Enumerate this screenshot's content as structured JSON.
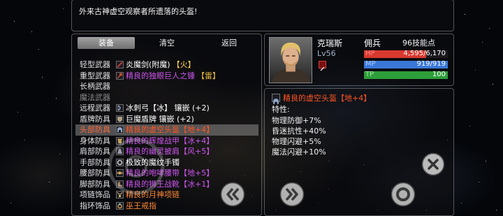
{
  "message": "外来古神虚空观察者所遗落的头盔!",
  "tabs": [
    {
      "label": "装备",
      "selected": true
    },
    {
      "label": "清空",
      "selected": false
    },
    {
      "label": "返回",
      "selected": false
    }
  ],
  "slots": [
    {
      "label": "轻型武器",
      "item": "炎魔剑(附魔)",
      "tag": "【火】",
      "item_color": "#ffffff",
      "tag_color": "#ffd24a",
      "icon": "sword-icon",
      "icon_color": "#e0443a"
    },
    {
      "label": "重型武器",
      "item": "精良的独眼巨人之锤",
      "tag": "【雷】",
      "item_color": "#cc55ee",
      "tag_color": "#f0c040",
      "icon": "hammer-icon",
      "icon_color": "#c0502a"
    },
    {
      "label": "长柄武器"
    },
    {
      "label": "魔法武器",
      "disabled": true
    },
    {
      "label": "远程武器",
      "item": "冰刺弓【冰】 镶嵌 (+2)",
      "item_color": "#ffffff",
      "icon": "bow-icon",
      "icon_color": "#9ab6d8"
    },
    {
      "label": "盾牌防具",
      "item": "巨魔盾牌 镶嵌 (+2)",
      "item_color": "#ffffff",
      "icon": "shield-icon",
      "icon_color": "#b0a080"
    },
    {
      "label": "头部防具",
      "item": "精良的虚空头盔【地+4】",
      "item_color": "#ff5522",
      "icon": "helmet-icon",
      "icon_color": "#8fa6c8",
      "selected": true
    },
    {
      "label": "身体防具",
      "item": "精良的辉煌战甲【冰+4】",
      "item_color": "#cc55ee",
      "icon": "armor-icon",
      "icon_color": "#c0a060"
    },
    {
      "label": "肩部防具",
      "item": "精良的幽灵披肩【风+5】",
      "item_color": "#cc55ee",
      "icon": "cloak-icon",
      "icon_color": "#9a9aaa"
    },
    {
      "label": "手部防具",
      "item": "极致的魔纹手镯",
      "item_color": "#ffffff",
      "icon": "bracer-icon",
      "icon_color": "#d0d0d0"
    },
    {
      "label": "腰部防具",
      "item": "精良的咆哮腰带【地+5】",
      "item_color": "#cc55ee",
      "icon": "belt-icon",
      "icon_color": "#a07850"
    },
    {
      "label": "脚部防具",
      "item": "精良的狮王战靴【冰+1】",
      "item_color": "#cc55ee",
      "icon": "boots-icon",
      "icon_color": "#9a7a5a"
    },
    {
      "label": "项链饰品",
      "item": "精良的月神项链",
      "item_color": "#ff8833",
      "icon": "necklace-icon",
      "icon_color": "#d8c070"
    },
    {
      "label": "指环饰品",
      "item": "巫王戒指",
      "item_color": "#ff8833",
      "icon": "ring-icon",
      "icon_color": "#d0a040"
    }
  ],
  "character": {
    "name": "克瑞斯",
    "class": "佣兵",
    "skill_points": "96技能点",
    "level": "Lv56",
    "status_icon": "buff-status-icon",
    "bars": [
      {
        "label": "HP",
        "value": "4,595/6,170",
        "fill": 0.745,
        "color": "#d8392e",
        "label_color": "#ff8a8a"
      },
      {
        "label": "MP",
        "value": "919/919",
        "fill": 1.0,
        "color": "#3a78d8",
        "label_color": "#a8ccff"
      },
      {
        "label": "TP",
        "value": "100",
        "fill": 1.0,
        "color": "#2e9e3a",
        "label_color": "#9fe89f"
      }
    ]
  },
  "detail": {
    "icon": "helmet-icon",
    "title": "精良的虚空头盔【地+4】",
    "title_color": "#ff5522",
    "traits_label": "特性:",
    "traits": [
      "物理防御+7%",
      "昏迷抗性+40%",
      "物理闪避+5%",
      "魔法闪避+10%"
    ]
  },
  "controls": {
    "close": "close-icon",
    "prev": "double-chevron-left-icon",
    "next": "double-chevron-right-icon",
    "confirm": "circle-icon",
    "joystick": "virtual-joystick-icon"
  }
}
